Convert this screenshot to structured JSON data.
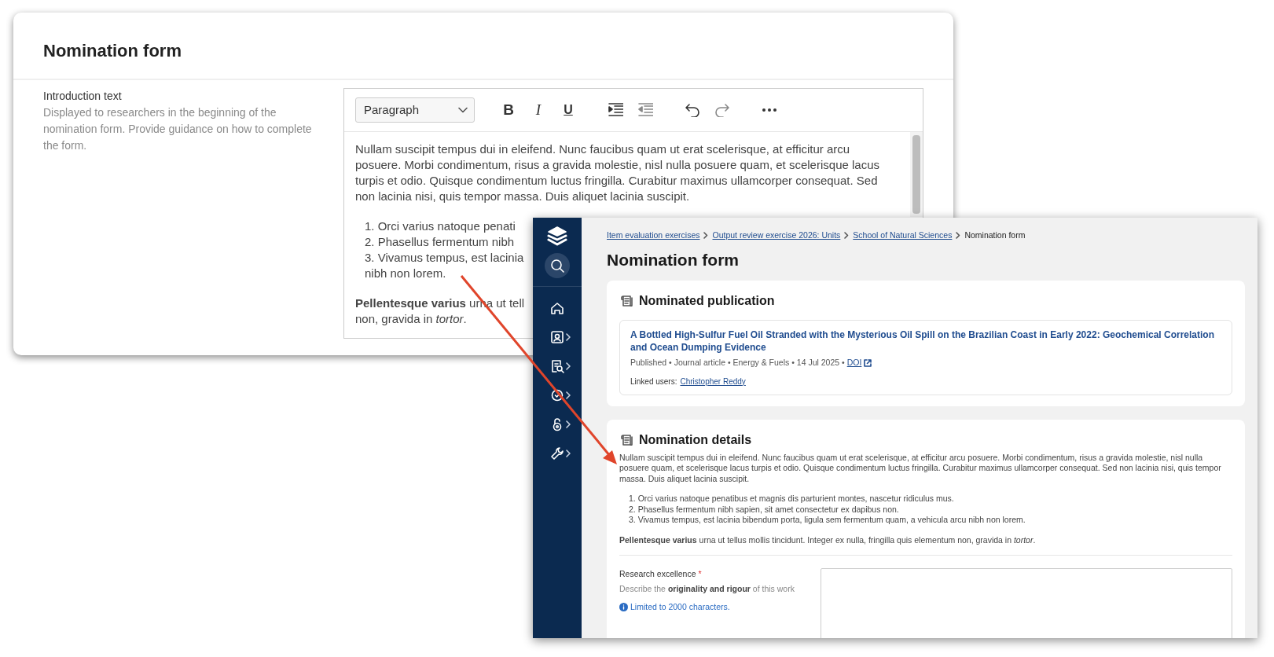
{
  "back_window": {
    "title": "Nomination form",
    "field": {
      "label": "Introduction text",
      "help": "Displayed to researchers in the beginning of the nomination form. Provide guidance on how to complete the form."
    },
    "editor": {
      "block_format": "Paragraph",
      "toolbar": [
        {
          "kind": "bold",
          "label": "B",
          "disabled": false
        },
        {
          "kind": "italic",
          "label": "I",
          "disabled": false
        },
        {
          "kind": "underline",
          "label": "U",
          "disabled": false
        },
        {
          "kind": "indent",
          "disabled": false
        },
        {
          "kind": "outdent",
          "disabled": true
        },
        {
          "kind": "undo",
          "disabled": false
        },
        {
          "kind": "redo",
          "disabled": true
        },
        {
          "kind": "more",
          "disabled": false
        }
      ],
      "paragraph": "Nullam suscipit tempus dui in eleifend. Nunc faucibus quam ut erat scelerisque, at efficitur arcu posuere. Morbi condimentum, risus a gravida molestie, nisl nulla posuere quam, et scelerisque lacus turpis et odio. Quisque condimentum luctus fringilla. Curabitur maximus ullamcorper consequat. Sed non lacinia nisi, quis tempor massa. Duis aliquet lacinia suscipit.",
      "list_items": [
        {
          "text": "1. Orci varius natoque penati"
        },
        {
          "text": "2. Phasellus fermentum nibh"
        },
        {
          "text": "3. Vivamus tempus, est lacinia",
          "continuation": "nibh non lorem."
        }
      ],
      "closing_lines": [
        "**Pellentesque varius** urna ut tell",
        "non, gravida in *tortor*."
      ]
    }
  },
  "front_window": {
    "sidebar": {
      "items": [
        {
          "kind": "home",
          "expandable": false
        },
        {
          "kind": "profile",
          "expandable": true
        },
        {
          "kind": "review",
          "expandable": true
        },
        {
          "kind": "settings",
          "expandable": true
        },
        {
          "kind": "open-access",
          "expandable": true
        },
        {
          "kind": "tools",
          "expandable": true
        }
      ]
    },
    "breadcrumbs": [
      {
        "label": "Item evaluation exercises",
        "link": true
      },
      {
        "label": "Output review exercise 2026: Units",
        "link": true
      },
      {
        "label": "School of Natural Sciences",
        "link": true
      },
      {
        "label": "Nomination form",
        "link": false
      }
    ],
    "title": "Nomination form",
    "publication_card": {
      "title": "Nominated publication",
      "publication_title": "A Bottled High-Sulfur Fuel Oil Stranded with the Mysterious Oil Spill on the Brazilian Coast in Early 2022: Geochemical Correlation and Ocean Dumping Evidence",
      "meta": "Published • Journal article • Energy & Fuels • 14 Jul 2025 •",
      "doi_link": "DOI",
      "linked_users_label": "Linked users:",
      "linked_user": "Christopher Reddy"
    },
    "details_card": {
      "title": "Nomination details",
      "paragraph": "Nullam suscipit tempus dui in eleifend. Nunc faucibus quam ut erat scelerisque, at efficitur arcu posuere. Morbi condimentum, risus a gravida molestie, nisl nulla posuere quam, et scelerisque lacus turpis et odio. Quisque condimentum luctus fringilla. Curabitur maximus ullamcorper consequat. Sed non lacinia nisi, quis tempor massa. Duis aliquet lacinia suscipit.",
      "list_items": [
        "1. Orci varius natoque penatibus et magnis dis parturient montes, nascetur ridiculus mus.",
        "2. Phasellus fermentum nibh sapien, sit amet consectetur ex dapibus non.",
        "3. Vivamus tempus, est lacinia bibendum porta, ligula sem fermentum quam, a vehicula arcu nibh non lorem."
      ],
      "closing": "**Pellentesque varius** urna ut tellus mollis tincidunt. Integer ex nulla, fringilla quis elementum non, gravida in *tortor*.",
      "field": {
        "label": "Research excellence",
        "required_mark": "*",
        "help": "Describe the **originality and rigour** of this work",
        "limit_note": "Limited to 2000 characters."
      }
    }
  }
}
